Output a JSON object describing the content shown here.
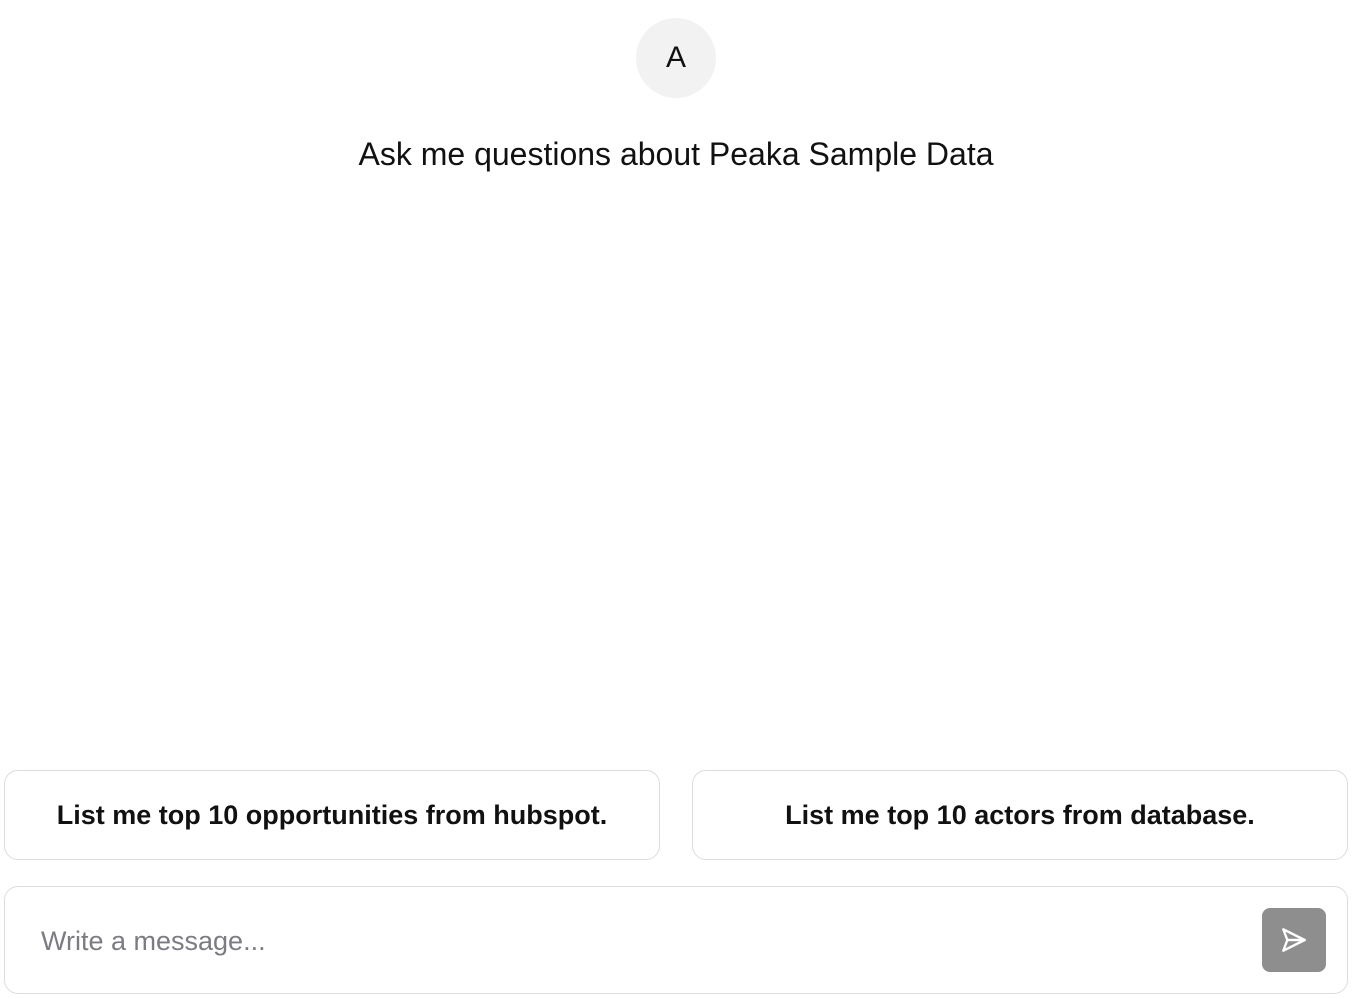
{
  "assistant": {
    "avatar_initial": "A",
    "welcome_text": "Ask me questions about Peaka Sample Data"
  },
  "suggestions": [
    {
      "label": "List me top 10 opportunities from hubspot."
    },
    {
      "label": "List me top 10 actors from database."
    }
  ],
  "composer": {
    "value": "",
    "placeholder": "Write a message...",
    "send_icon": "send-icon",
    "send_button_color": "#8e8e8e"
  }
}
